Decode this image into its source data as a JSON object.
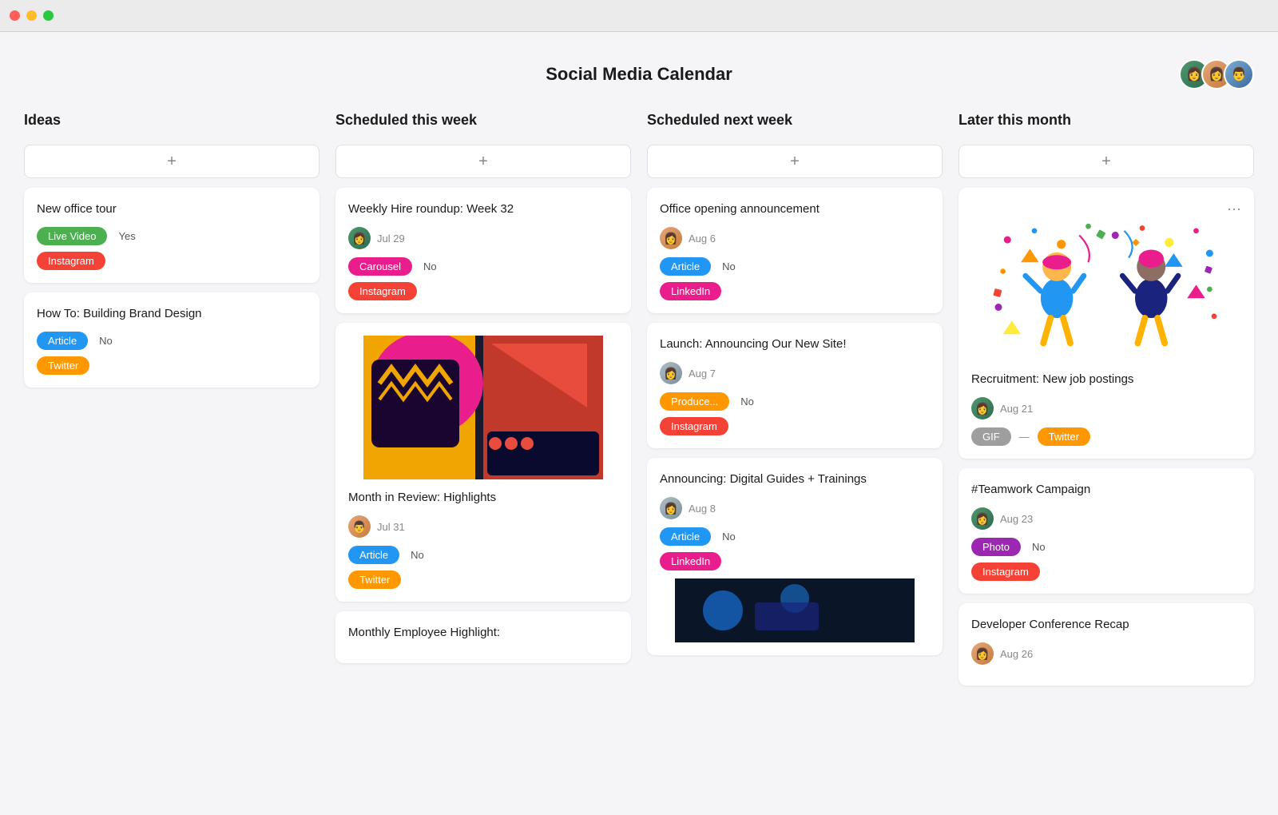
{
  "titleBar": {
    "dots": [
      "red",
      "yellow",
      "green"
    ]
  },
  "header": {
    "title": "Social Media Calendar",
    "avatars": [
      "avatar1",
      "avatar2",
      "avatar3"
    ]
  },
  "columns": [
    {
      "id": "ideas",
      "label": "Ideas",
      "addLabel": "+",
      "cards": [
        {
          "id": "card-new-office",
          "title": "New office tour",
          "tags": [
            {
              "label": "Live Video",
              "color": "tag-green"
            },
            {
              "label": "Yes",
              "color": null
            }
          ],
          "extraTags": [
            {
              "label": "Instagram",
              "color": "tag-red"
            }
          ],
          "hasAvatar": false,
          "date": null
        },
        {
          "id": "card-brand-design",
          "title": "How To: Building Brand Design",
          "tags": [
            {
              "label": "Article",
              "color": "tag-blue"
            },
            {
              "label": "No",
              "color": null
            }
          ],
          "extraTags": [
            {
              "label": "Twitter",
              "color": "tag-orange"
            }
          ],
          "hasAvatar": false,
          "date": null
        }
      ]
    },
    {
      "id": "scheduled-this-week",
      "label": "Scheduled this week",
      "addLabel": "+",
      "cards": [
        {
          "id": "card-weekly-hire",
          "title": "Weekly Hire roundup: Week 32",
          "hasAvatar": true,
          "avatarColor": "#4CAF50",
          "date": "Jul 29",
          "tags": [
            {
              "label": "Carousel",
              "color": "tag-pink"
            },
            {
              "label": "No",
              "color": null
            }
          ],
          "extraTags": [
            {
              "label": "Instagram",
              "color": "tag-red"
            }
          ]
        },
        {
          "id": "card-month-review",
          "title": "Month in Review: Highlights",
          "hasImage": true,
          "hasAvatar": true,
          "avatarColor": "#FF9800",
          "date": "Jul 31",
          "tags": [
            {
              "label": "Article",
              "color": "tag-blue"
            },
            {
              "label": "No",
              "color": null
            }
          ],
          "extraTags": [
            {
              "label": "Twitter",
              "color": "tag-orange"
            }
          ]
        },
        {
          "id": "card-monthly-employee",
          "title": "Monthly Employee Highlight:",
          "hasAvatar": false,
          "date": null,
          "tags": [],
          "extraTags": [],
          "truncated": true
        }
      ]
    },
    {
      "id": "scheduled-next-week",
      "label": "Scheduled next week",
      "addLabel": "+",
      "cards": [
        {
          "id": "card-office-opening",
          "title": "Office opening announcement",
          "hasAvatar": true,
          "avatarColor": "#FF9800",
          "date": "Aug 6",
          "tags": [
            {
              "label": "Article",
              "color": "tag-blue"
            },
            {
              "label": "No",
              "color": null
            }
          ],
          "extraTags": [
            {
              "label": "LinkedIn",
              "color": "tag-pink"
            }
          ]
        },
        {
          "id": "card-new-site",
          "title": "Launch: Announcing Our New Site!",
          "hasAvatar": true,
          "avatarColor": "#9E9E9E",
          "date": "Aug 7",
          "tags": [
            {
              "label": "Produce...",
              "color": "tag-orange"
            },
            {
              "label": "No",
              "color": null
            }
          ],
          "extraTags": [
            {
              "label": "Instagram",
              "color": "tag-red"
            }
          ]
        },
        {
          "id": "card-digital-guides",
          "title": "Announcing: Digital Guides + Trainings",
          "hasImage": true,
          "hasAvatar": true,
          "avatarColor": "#9E9E9E",
          "date": "Aug 8",
          "tags": [
            {
              "label": "Article",
              "color": "tag-blue"
            },
            {
              "label": "No",
              "color": null
            }
          ],
          "extraTags": [
            {
              "label": "LinkedIn",
              "color": "tag-pink"
            }
          ]
        }
      ]
    },
    {
      "id": "later-this-month",
      "label": "Later this month",
      "addLabel": "+",
      "cards": [
        {
          "id": "card-recruitment",
          "title": "Recruitment: New job postings",
          "hasCelebrationImage": true,
          "hasAvatar": true,
          "avatarColor": "#4CAF50",
          "date": "Aug 21",
          "tags": [
            {
              "label": "GIF",
              "color": "tag-gray"
            },
            {
              "label": "Twitter",
              "color": "tag-orange"
            }
          ],
          "extraTags": [],
          "hasMore": true
        },
        {
          "id": "card-teamwork",
          "title": "#Teamwork Campaign",
          "hasAvatar": true,
          "avatarColor": "#4CAF50",
          "date": "Aug 23",
          "tags": [
            {
              "label": "Photo",
              "color": "tag-purple"
            },
            {
              "label": "No",
              "color": null
            }
          ],
          "extraTags": [
            {
              "label": "Instagram",
              "color": "tag-red"
            }
          ]
        },
        {
          "id": "card-dev-conference",
          "title": "Developer Conference Recap",
          "hasAvatar": true,
          "avatarColor": "#FF9800",
          "date": "Aug 26",
          "tags": [],
          "extraTags": [],
          "truncated": true
        }
      ]
    }
  ]
}
